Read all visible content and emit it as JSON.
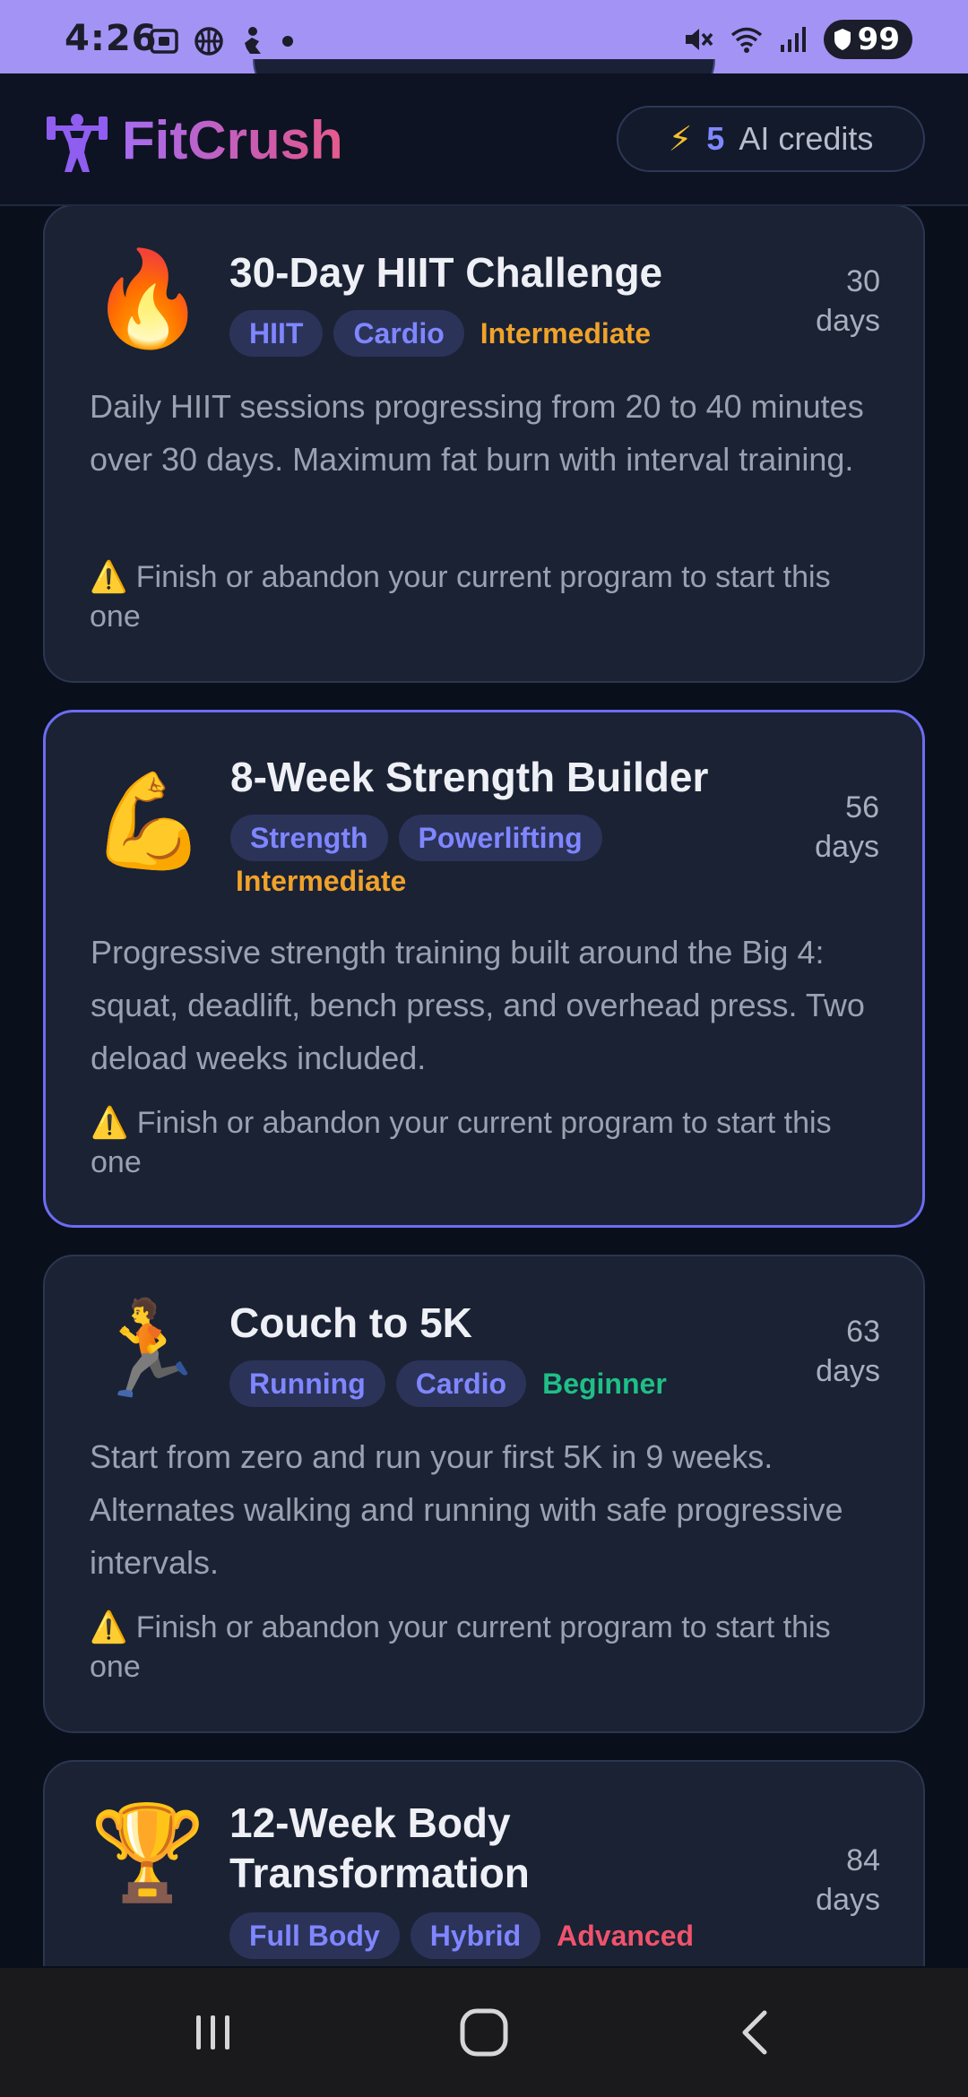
{
  "status_bar": {
    "time": "4:26",
    "battery": "99",
    "left_icons": [
      "screenshot-icon",
      "basketball-icon",
      "person-icon",
      "dot-icon"
    ],
    "right_icons": [
      "mute-icon",
      "wifi-icon",
      "signal-icon",
      "battery-shield-icon"
    ]
  },
  "header": {
    "app_name": "FitCrush",
    "logo_icon": "weightlifter-icon",
    "credits_icon": "⚡",
    "credits_count": "5",
    "credits_label": "AI credits"
  },
  "programs": [
    {
      "emoji": "🔥",
      "title": "30-Day HIIT Challenge",
      "tags": [
        "HIIT",
        "Cardio"
      ],
      "level": "Intermediate",
      "duration_value": "30",
      "duration_unit": "days",
      "description": "Daily HIIT sessions progressing from 20 to 40 minutes over 30 days. Maximum fat burn with interval training.",
      "warning": "⚠️ Finish or abandon your current program to start this one",
      "selected": false
    },
    {
      "emoji": "💪",
      "title": "8-Week Strength Builder",
      "tags": [
        "Strength",
        "Powerlifting"
      ],
      "level": "Intermediate",
      "duration_value": "56",
      "duration_unit": "days",
      "description": "Progressive strength training built around the Big 4: squat, deadlift, bench press, and overhead press. Two deload weeks included.",
      "warning": "⚠️ Finish or abandon your current program to start this one",
      "selected": true
    },
    {
      "emoji": "🏃",
      "title": "Couch to 5K",
      "tags": [
        "Running",
        "Cardio"
      ],
      "level": "Beginner",
      "duration_value": "63",
      "duration_unit": "days",
      "description": "Start from zero and run your first 5K in 9 weeks. Alternates walking and running with safe progressive intervals.",
      "warning": "⚠️ Finish or abandon your current program to start this one",
      "selected": false
    },
    {
      "emoji": "🏆",
      "title": "12-Week Body Transformation",
      "tags": [
        "Full Body",
        "Hybrid"
      ],
      "level": "Advanced",
      "duration_value": "84",
      "duration_unit": "days",
      "selected": false
    }
  ],
  "nav_bar": {
    "recents_icon": "recents-icon",
    "home_icon": "home-icon",
    "back_icon": "back-icon"
  },
  "colors": {
    "accent": "#6d6cf2",
    "intermediate": "#f0a22a",
    "beginner": "#1fbf86",
    "advanced": "#f0536c",
    "status_bar": "#a393f5"
  }
}
